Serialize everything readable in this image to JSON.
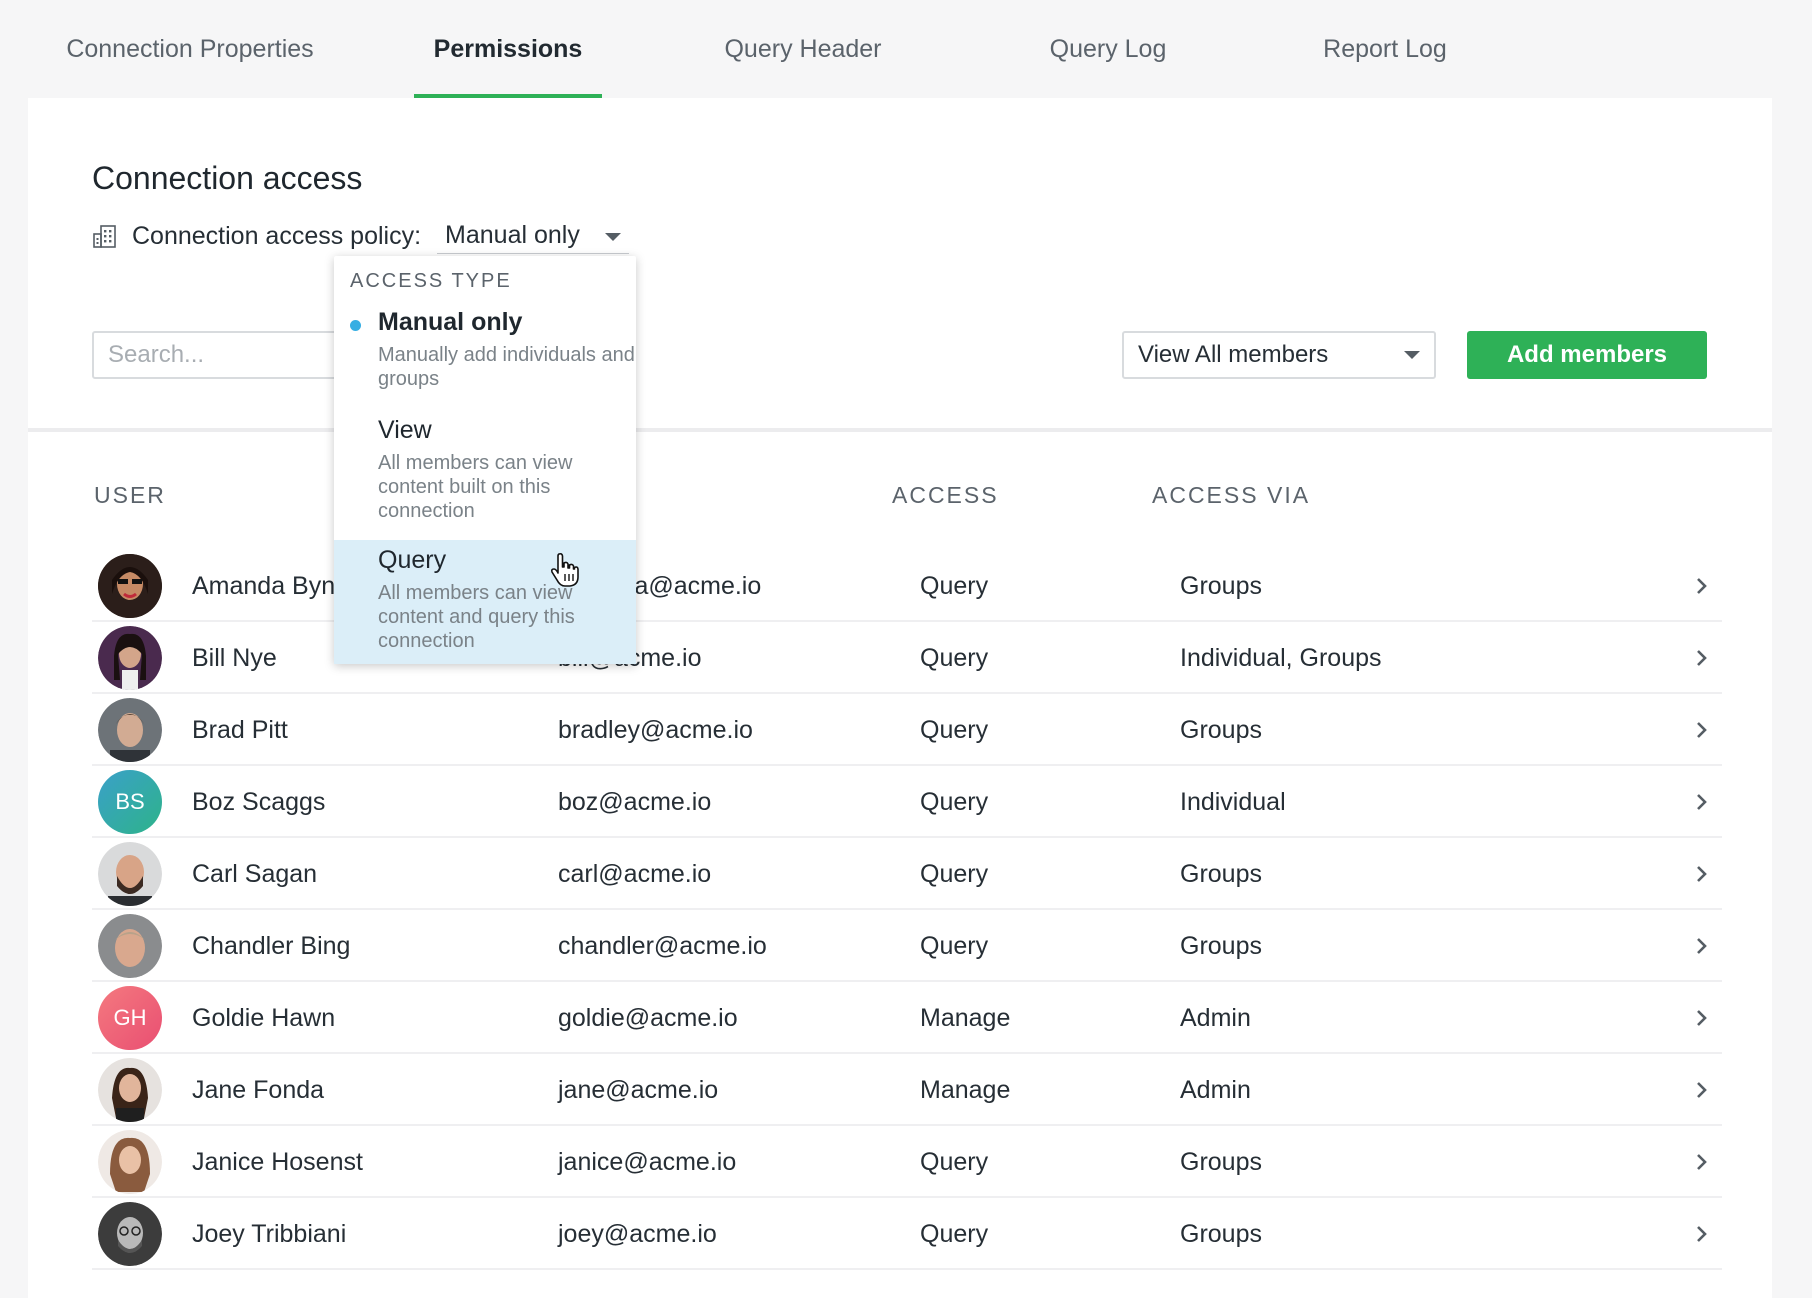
{
  "tabs": [
    {
      "label": "Connection Properties"
    },
    {
      "label": "Permissions"
    },
    {
      "label": "Query Header"
    },
    {
      "label": "Query Log"
    },
    {
      "label": "Report Log"
    }
  ],
  "section_title": "Connection access",
  "policy": {
    "label": "Connection access policy:",
    "value": "Manual only",
    "icon": "building-icon"
  },
  "search": {
    "placeholder": "Search..."
  },
  "view_filter": {
    "value": "View All members"
  },
  "add_members_label": "Add members",
  "table": {
    "headers": {
      "user": "USER",
      "access": "ACCESS",
      "access_via": "ACCESS VIA"
    },
    "rows": [
      {
        "name": "Amanda Bynes",
        "email": "amanda@acme.io",
        "access": "Query",
        "via": "Groups",
        "avatar": "photo"
      },
      {
        "name": "Bill Nye",
        "email": "bill@acme.io",
        "access": "Query",
        "via": "Individual, Groups",
        "avatar": "photo"
      },
      {
        "name": "Brad Pitt",
        "email": "bradley@acme.io",
        "access": "Query",
        "via": "Groups",
        "avatar": "photo"
      },
      {
        "name": "Boz Scaggs",
        "email": "boz@acme.io",
        "access": "Query",
        "via": "Individual",
        "avatar": "BS"
      },
      {
        "name": "Carl Sagan",
        "email": "carl@acme.io",
        "access": "Query",
        "via": "Groups",
        "avatar": "photo"
      },
      {
        "name": "Chandler Bing",
        "email": "chandler@acme.io",
        "access": "Query",
        "via": "Groups",
        "avatar": "photo"
      },
      {
        "name": "Goldie Hawn",
        "email": "goldie@acme.io",
        "access": "Manage",
        "via": "Admin",
        "avatar": "GH"
      },
      {
        "name": "Jane Fonda",
        "email": "jane@acme.io",
        "access": "Manage",
        "via": "Admin",
        "avatar": "photo"
      },
      {
        "name": "Janice Hosenst",
        "email": "janice@acme.io",
        "access": "Query",
        "via": "Groups",
        "avatar": "photo"
      },
      {
        "name": "Joey Tribbiani",
        "email": "joey@acme.io",
        "access": "Query",
        "via": "Groups",
        "avatar": "photo"
      }
    ]
  },
  "dropdown": {
    "header": "ACCESS TYPE",
    "options": [
      {
        "title": "Manual only",
        "desc": "Manually add individuals and groups"
      },
      {
        "title": "View",
        "desc": "All members can view content built on this connection"
      },
      {
        "title": "Query",
        "desc": "All members can view content and query this connection"
      }
    ]
  },
  "colors": {
    "accent_green": "#2eb157",
    "selected_dot": "#36aee3",
    "hover_option": "#dbeef8",
    "boz_avatar": "#2f9fb8",
    "goldie_avatar": "#f06b78"
  }
}
